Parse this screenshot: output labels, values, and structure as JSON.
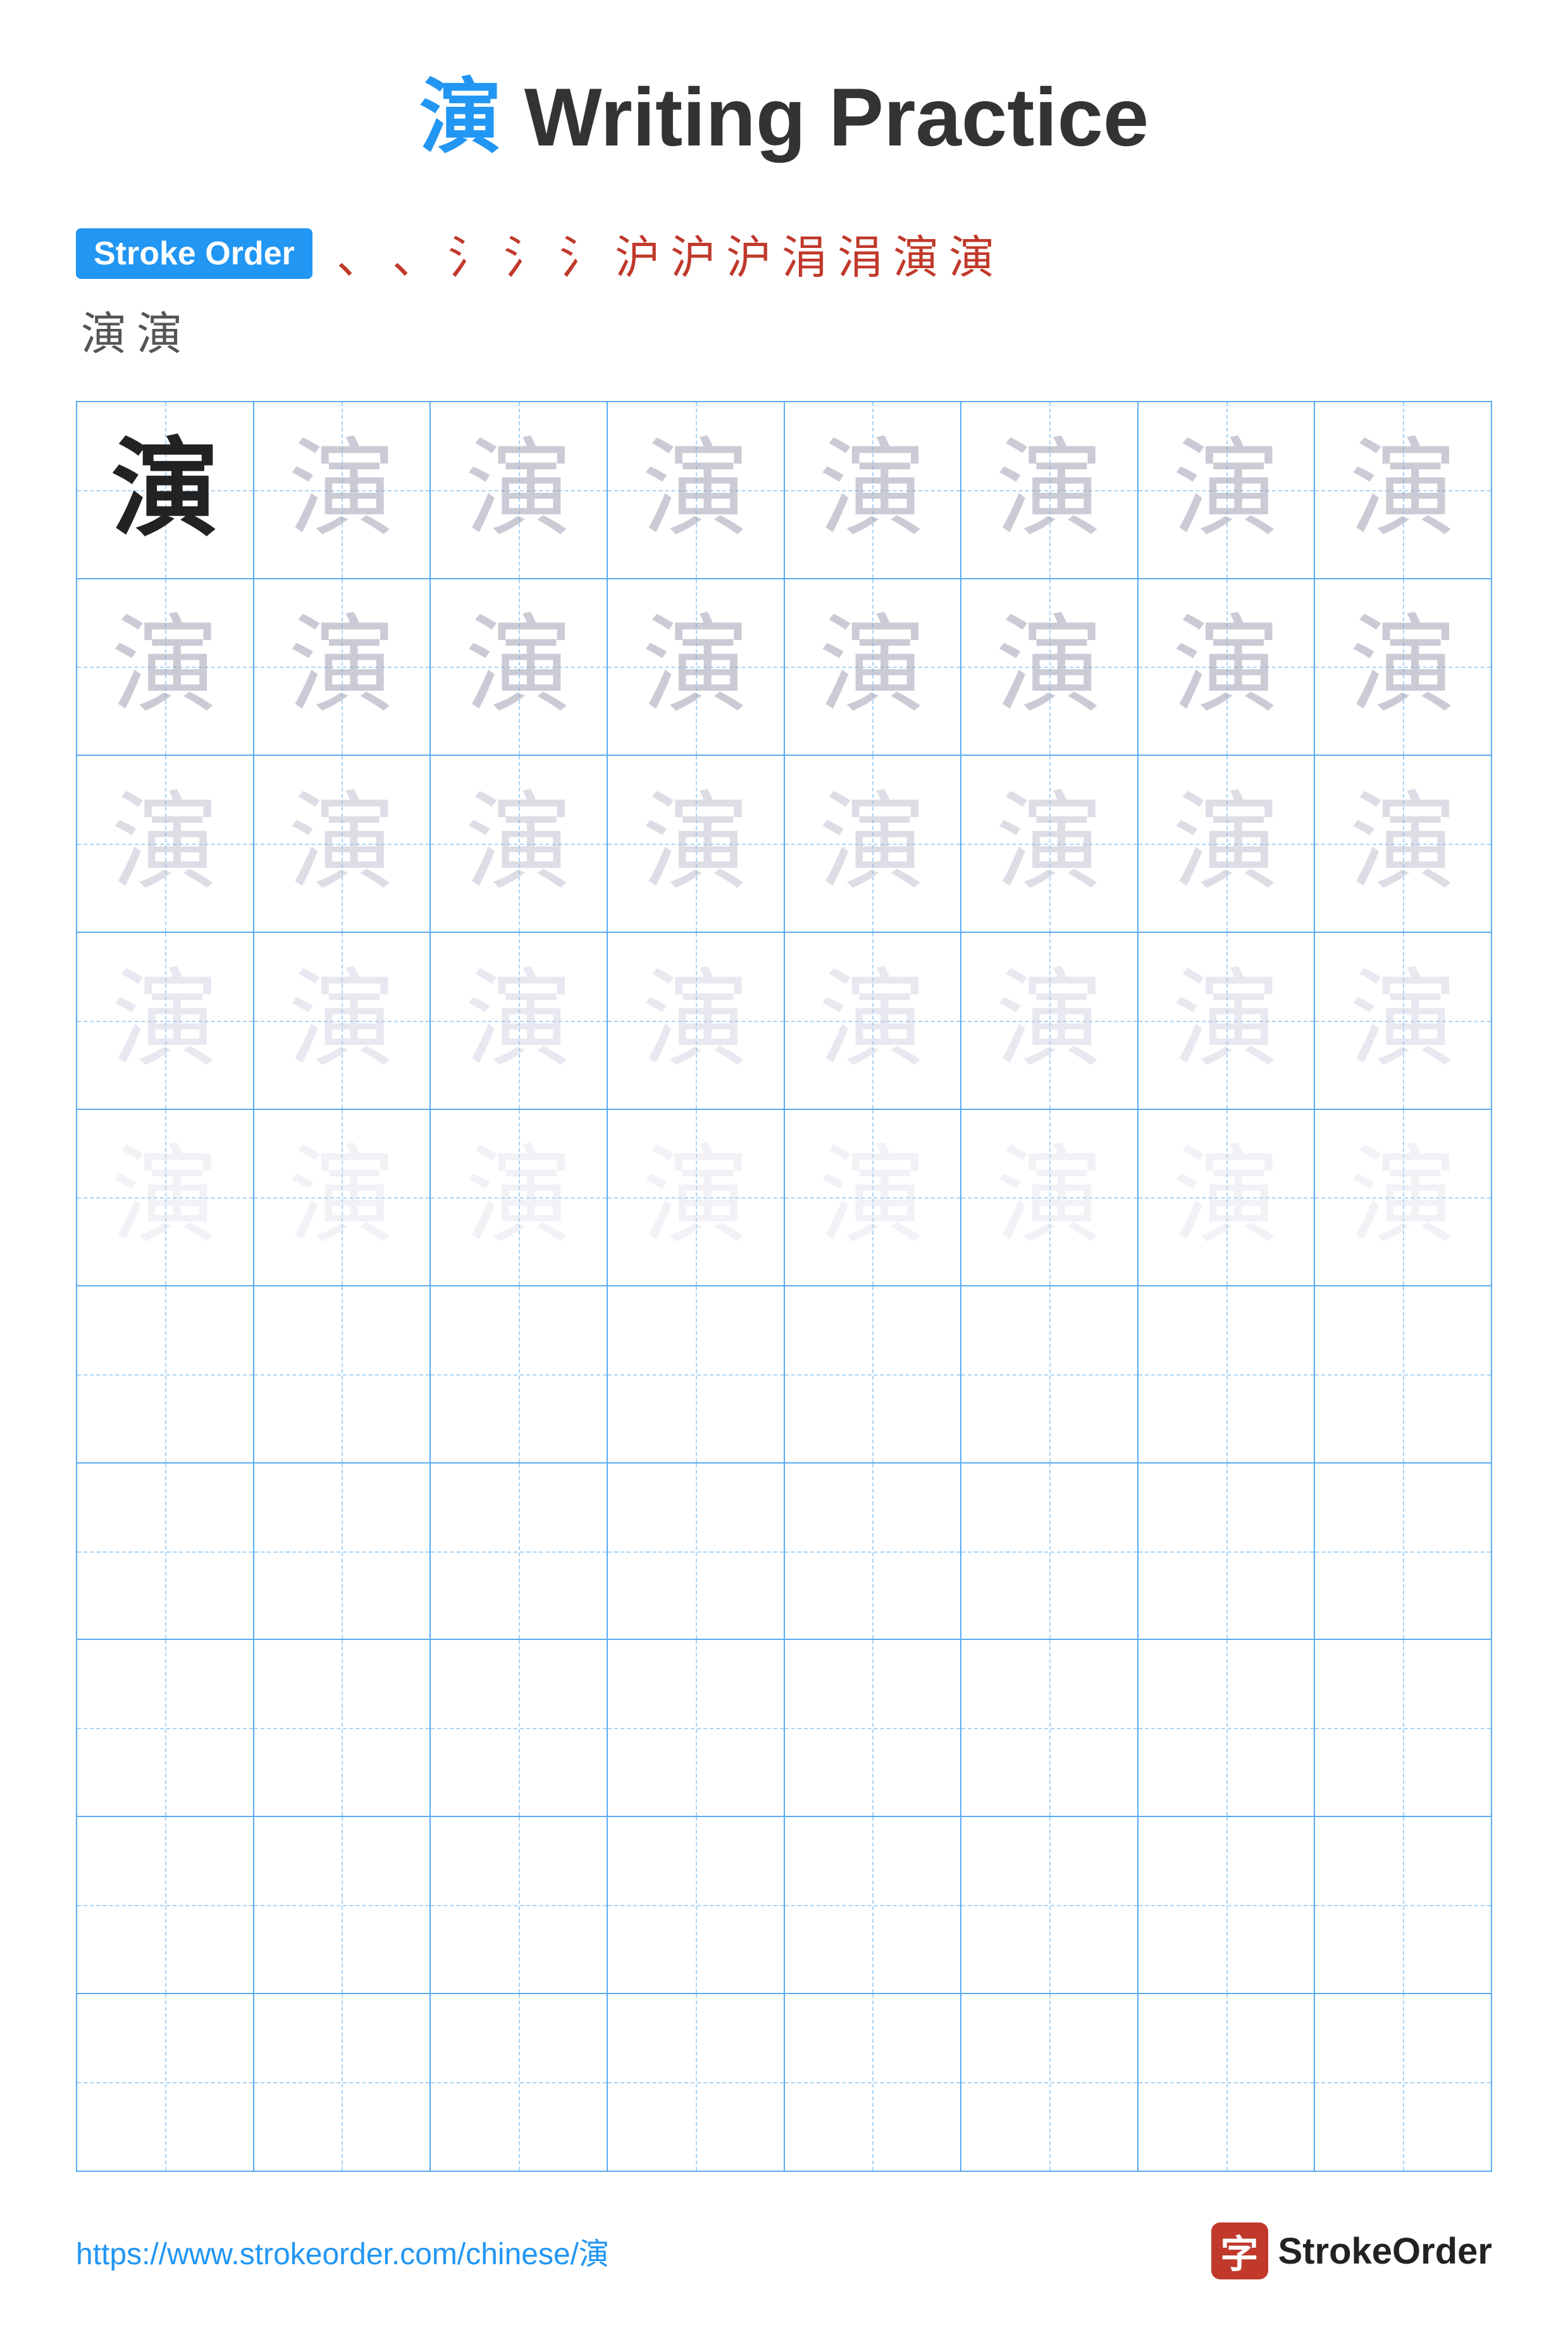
{
  "title": {
    "chinese_char": "演",
    "text": " Writing Practice"
  },
  "stroke_order": {
    "badge_label": "Stroke Order",
    "strokes": [
      "、",
      "、",
      "氵",
      "氵",
      "氵",
      "沪",
      "沪",
      "沪",
      "涓",
      "涓",
      "演",
      "演"
    ],
    "extra_chars": [
      "演",
      "演"
    ]
  },
  "grid": {
    "cols": 8,
    "rows_with_char": 5,
    "rows_empty": 5,
    "char": "演",
    "opacity_levels": [
      "dark",
      "light1",
      "light1",
      "light1",
      "light1",
      "light1",
      "light1",
      "light1",
      "light1",
      "light1",
      "light1",
      "light1",
      "light1",
      "light1",
      "light1",
      "light1",
      "light2",
      "light2",
      "light2",
      "light2",
      "light2",
      "light2",
      "light2",
      "light2",
      "light3",
      "light3",
      "light3",
      "light3",
      "light3",
      "light3",
      "light3",
      "light3",
      "light4",
      "light4",
      "light4",
      "light4",
      "light4",
      "light4",
      "light4",
      "light4"
    ]
  },
  "footer": {
    "url": "https://www.strokeorder.com/chinese/演",
    "logo_char": "字",
    "logo_text": "StrokeOrder"
  }
}
